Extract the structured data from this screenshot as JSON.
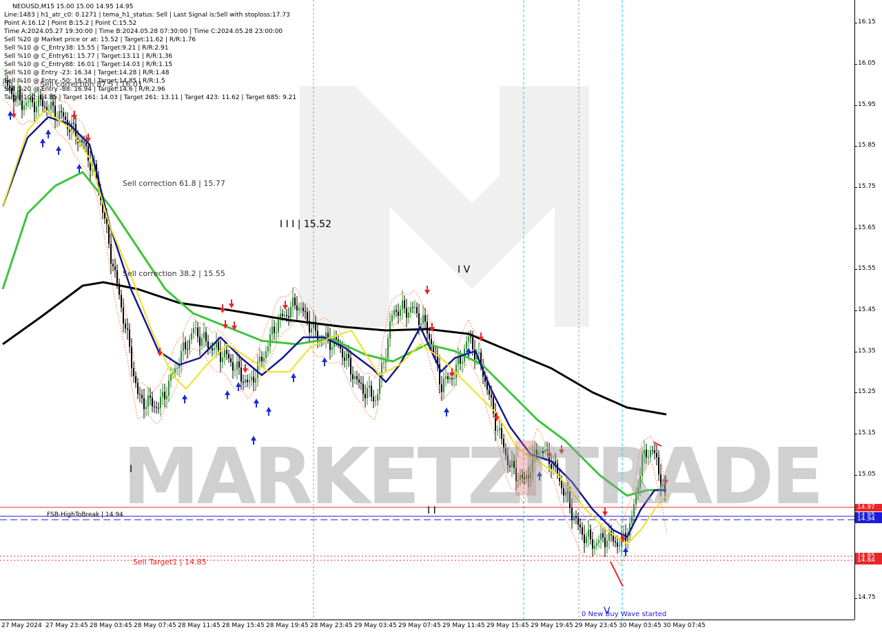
{
  "window": {
    "symbol_line": "NEOUSD,M15  15.00 15.00 14.95 14.95"
  },
  "info_panel": {
    "lines": [
      "Line:1483  |  h1_atr_c0: 0.1271  |  tema_h1_status: Sell  |  Last Signal is:Sell with stoploss:17.73",
      "Point A:16.12  |  Point B:15.2  |  Point C:15.52",
      "Time A:2024.05.27 19:30:00  |  Time B:2024.05.28 07:30:00  |  Time C:2024.05.28 23:00:00",
      "Sell %20 @ Market price or at: 15.52  |  Target:11.62  |  R/R:1.76",
      "Sell %10 @ C_Entry38: 15.55  |  Target:9.21  |  R/R:2.91",
      "Sell %10 @ C_Entry61: 15.77  |  Target:13.11  |  R/R:1.36",
      "Sell %10 @ C_Entry88: 16.01  |  Target:14.03  |  R/R:1.15",
      "Sell %10 @ Entry -23: 16.34  |  Target:14.28  |  R/R:1.48",
      "Sell %10 @ Entry -50: 16.58  |  Target:14.85  |  R/R:1.5",
      "Sell %20 @ Entry -88: 16.94  |  Target:14.6  |  R/R:2.96",
      "Target100: 14.85  |  Target 161: 14.03  |  Target 261: 13.11  |  Target 423: 11.62  |  Target 685: 9.21"
    ]
  },
  "annotations": {
    "sell_correction_875": "Sell correction 87.5 | 16.01",
    "sell_correction_618": "Sell correction 61.8 | 15.77",
    "sell_correction_382": "Sell correction 38.2 | 15.55",
    "wave_iii": "I I I | 15.52",
    "wave_iv": "I V",
    "wave_i": "I",
    "wave_ii": "I I",
    "wave_v": "V",
    "fsb_label": "FSB-HighToBreak | 14.94",
    "sell_target": "Sell Target1 | 14.85",
    "new_wave": "0 New Buy Wave started",
    "watermark": "MARKETZITRADE"
  },
  "price_scale": {
    "ticks": [
      "16.15",
      "16.05",
      "15.95",
      "15.85",
      "15.75",
      "15.65",
      "15.55",
      "15.45",
      "15.35",
      "15.25",
      "15.15",
      "15.05",
      "14.75"
    ],
    "tags": [
      {
        "text": "14.97",
        "color": "#e8262a"
      },
      {
        "text": "14.95",
        "color": "#1b1bd8"
      },
      {
        "text": "14.94",
        "color": "#1b1bd8"
      },
      {
        "text": "14.85",
        "color": "#e8262a"
      },
      {
        "text": "14.84",
        "color": "#e8262a"
      }
    ]
  },
  "time_scale": {
    "ticks": [
      "27 May 2024",
      "27 May 23:45",
      "28 May 03:45",
      "28 May 07:45",
      "28 May 11:45",
      "28 May 15:45",
      "28 May 19:45",
      "28 May 23:45",
      "29 May 03:45",
      "29 May 07:45",
      "29 May 11:45",
      "29 May 15:45",
      "29 May 19:45",
      "29 May 23:45",
      "30 May 03:45",
      "30 May 07:45"
    ]
  },
  "colors": {
    "bull_candle": "#2d8a2d",
    "bear_candle": "#000000",
    "ma_black": "#000000",
    "ma_green": "#3cc43c",
    "ma_navy": "#14148c",
    "ma_yellow": "#f0e020",
    "channel_orange": "#ff6a20",
    "level_red": "#e8262a",
    "level_blue": "#1b1bd8",
    "session_cyan": "#00d8e8",
    "sell_arrow": "#e8262a",
    "buy_arrow": "#1b2ad8"
  }
}
